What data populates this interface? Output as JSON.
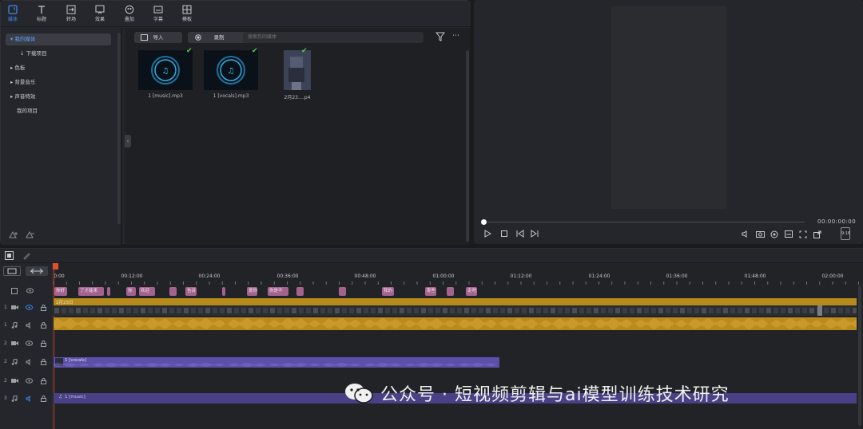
{
  "toolbar": {
    "tabs": [
      {
        "label": "媒体",
        "icon": "media-icon",
        "active": true
      },
      {
        "label": "标题",
        "icon": "title-icon"
      },
      {
        "label": "转场",
        "icon": "transition-icon"
      },
      {
        "label": "效果",
        "icon": "effects-icon"
      },
      {
        "label": "叠加",
        "icon": "overlay-icon"
      },
      {
        "label": "字幕",
        "icon": "subtitle-icon"
      },
      {
        "label": "模板",
        "icon": "template-icon"
      }
    ]
  },
  "sidebar": {
    "items": [
      {
        "label": "▾ 我的媒体",
        "selected": true
      },
      {
        "label": "↓ 下载项目"
      },
      {
        "label": "▸ 色板"
      },
      {
        "label": "▸ 背景音乐"
      },
      {
        "label": "▸ 声音特效"
      },
      {
        "label": "我的项目"
      }
    ]
  },
  "media": {
    "import_label": "导入",
    "record_label": "录制",
    "search_placeholder": "搜索您的媒体",
    "items": [
      {
        "name": "1 [music].mp3",
        "type": "audio",
        "checked": true
      },
      {
        "name": "1 [vocals].mp3",
        "type": "audio",
        "checked": true
      },
      {
        "name": "2月23.…p4",
        "type": "video",
        "checked": true
      }
    ]
  },
  "preview": {
    "timecode": "00:00:00:00",
    "ratio": "9:16"
  },
  "timeline": {
    "ticks": [
      "0:00",
      "00:12:00",
      "00:24:00",
      "00:36:00",
      "00:48:00",
      "01:00:00",
      "01:12:00",
      "01:24:00",
      "01:36:00",
      "01:48:00",
      "02:00:00"
    ],
    "markers": [
      "你好",
      "了才能来",
      "你",
      "欢迎",
      "",
      "告诉",
      "",
      "",
      "爱你",
      "你是不",
      "",
      "",
      "我的",
      "那些",
      "",
      "走吧"
    ],
    "tracks": [
      {
        "num": "1",
        "type": "video"
      },
      {
        "num": "1",
        "type": "audio"
      },
      {
        "num": "2",
        "type": "video"
      },
      {
        "num": "2",
        "type": "audio"
      },
      {
        "num": "2",
        "type": "video"
      },
      {
        "num": "3",
        "type": "audio"
      }
    ],
    "clips": {
      "video_label": "2月23日",
      "vocals_label": "1 [vocals]",
      "music_label": "1 [music]"
    }
  },
  "watermark": {
    "text": "公众号 · 短视频剪辑与ai模型训练技术研究"
  },
  "colors": {
    "accent": "#3e8cf0",
    "marker": "#a4628f",
    "video_track": "#b78a1e",
    "audio_track": "#5b4fa8"
  }
}
